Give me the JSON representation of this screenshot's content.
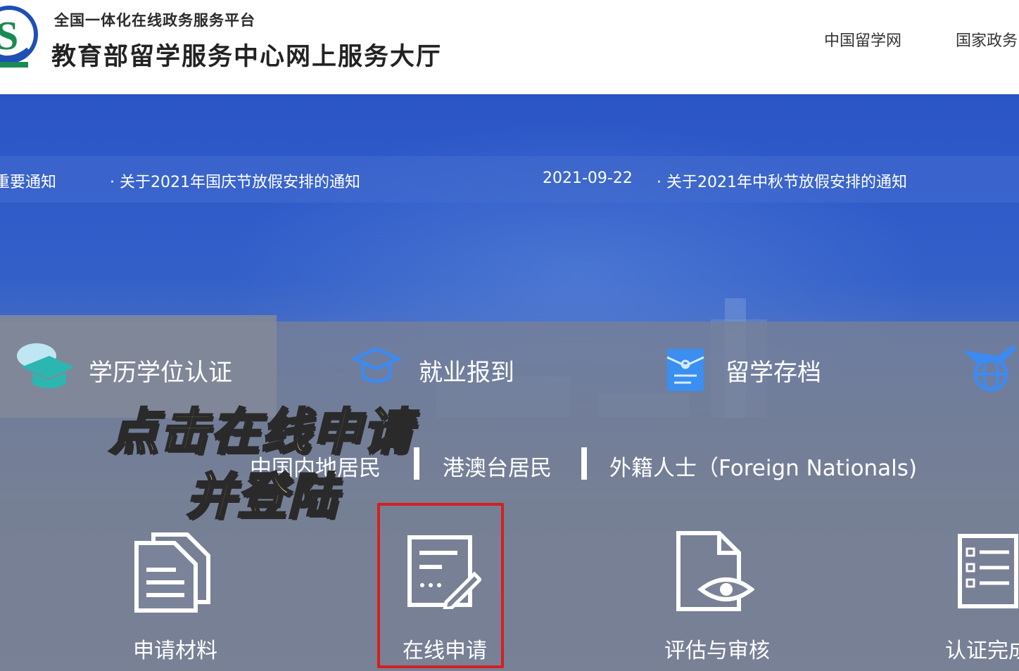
{
  "header": {
    "platform": "全国一体化在线政务服务平台",
    "site_title": "教育部留学服务中心网上服务大厅",
    "links": [
      "中国留学网",
      "国家政务"
    ]
  },
  "notices": {
    "label": "重要通知",
    "item1": "· 关于2021年国庆节放假安排的通知",
    "date2": "2021-09-22",
    "item2": "· 关于2021年中秋节放假安排的通知"
  },
  "categories": [
    "学历学位认证",
    "就业报到",
    "留学存档"
  ],
  "sub_tabs": [
    "中国内地居民",
    "港澳台居民",
    "外籍人士（Foreign Nationals)"
  ],
  "overlay": {
    "line1": "点击在线申请",
    "line2": "并登陆"
  },
  "services": [
    "申请材料",
    "在线申请",
    "评估与审核",
    "认证完成"
  ],
  "colors": {
    "accent_blue": "#2e5bc9",
    "highlight": "#d42020",
    "overlay_text": "#fbe58a"
  }
}
